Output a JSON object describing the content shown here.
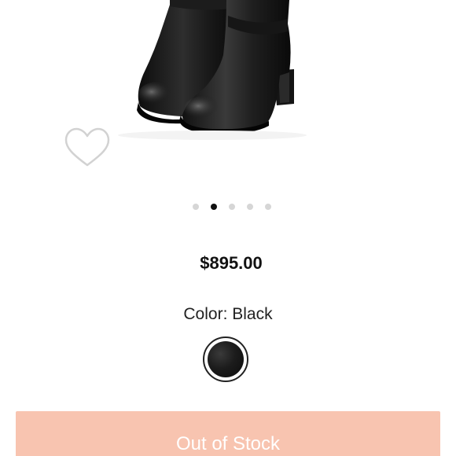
{
  "product": {
    "image_icon": "leather-ankle-boot-image",
    "favorite_icon": "heart-outline-icon",
    "carousel": {
      "count": 5,
      "active_index": 1
    },
    "price": "$895.00",
    "color_label": "Color: Black",
    "swatch_color": "#151515"
  },
  "cta": {
    "label": "Out of Stock",
    "background": "#f8c4b0",
    "text_color": "#ffffff"
  }
}
